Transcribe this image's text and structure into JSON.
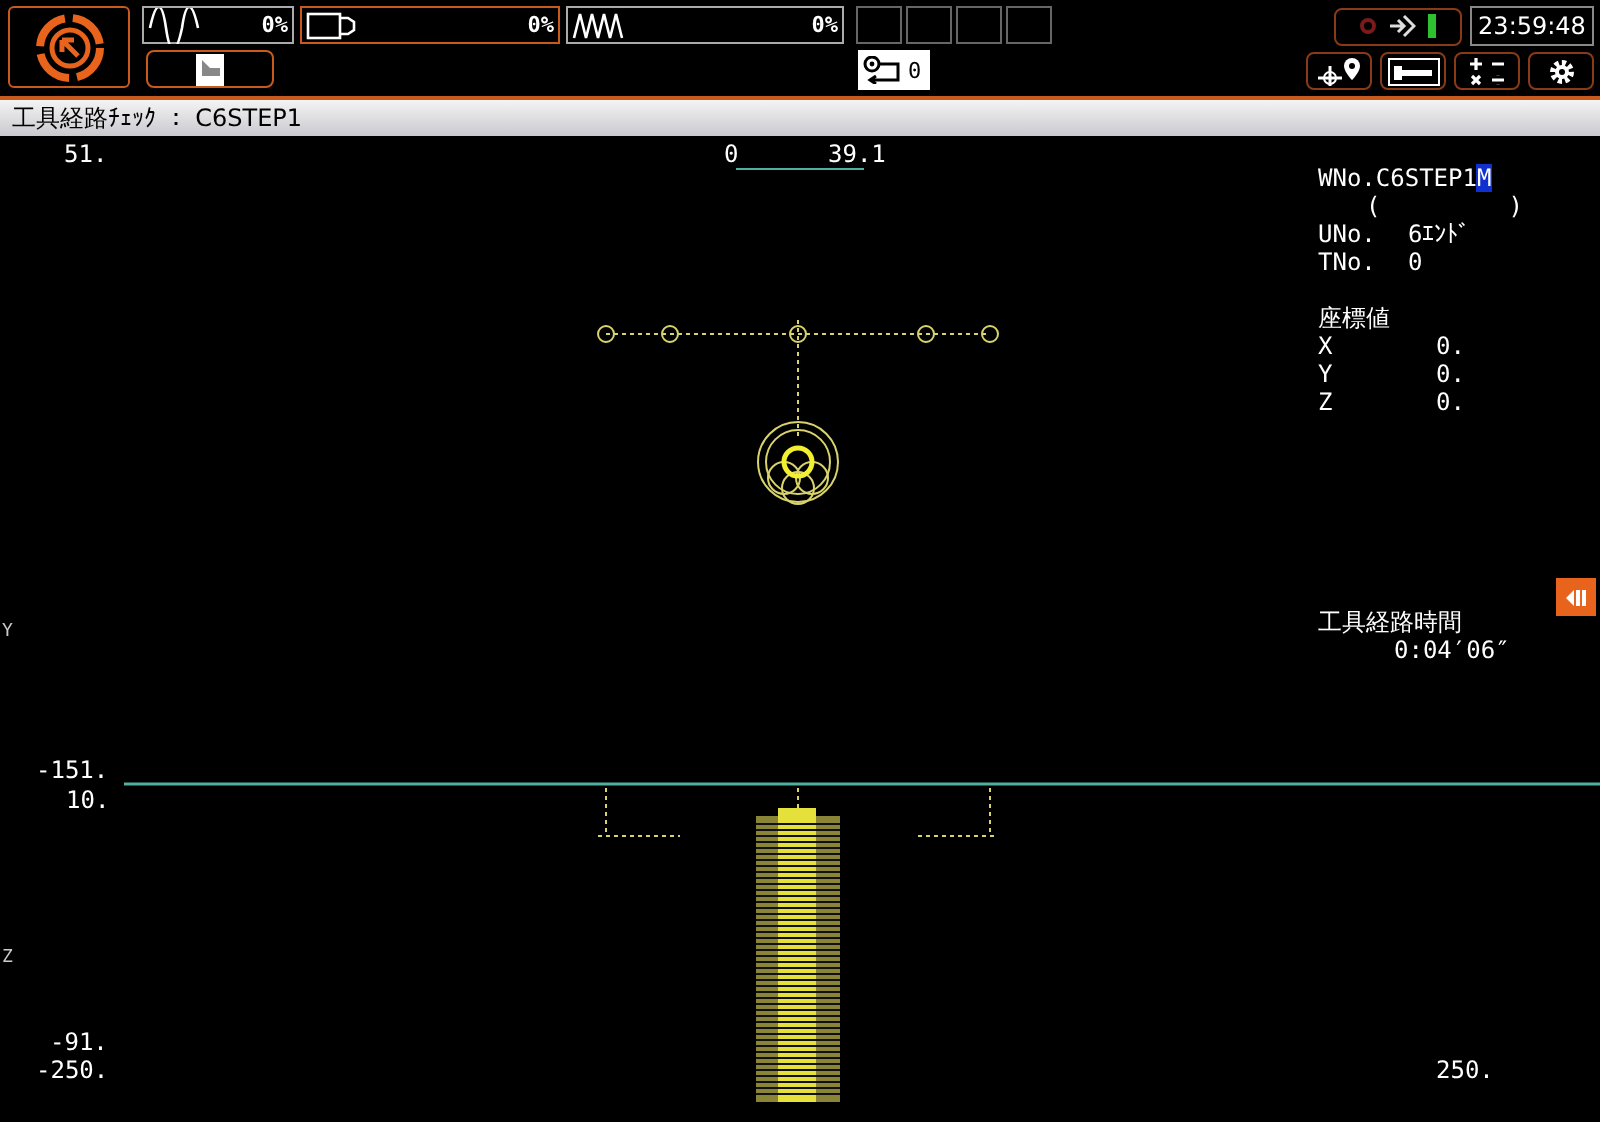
{
  "header": {
    "gauges": [
      {
        "kind": "sine",
        "reading": "0%"
      },
      {
        "kind": "tool",
        "reading": "0%"
      },
      {
        "kind": "triangle",
        "reading": "0%"
      }
    ],
    "counter": {
      "reading": "0"
    },
    "clock": "23:59:48"
  },
  "title_bar": {
    "title": "工具経路ﾁｪｯｸ ： C6STEP1"
  },
  "view": {
    "top_scale": {
      "left_value": "51.",
      "start": "0",
      "end": "39.1"
    },
    "upper_view": {
      "axis": "Y",
      "bottom_value": "-151."
    },
    "lower_view": {
      "axis": "Z",
      "top_value": "10.",
      "bottom_value": "-91.",
      "left_value": "-250.",
      "right_value": "250."
    }
  },
  "info": {
    "program_no": "WNo.C6STEP1",
    "cursor": "M",
    "comment_open": "(",
    "comment_close": ")",
    "unit_label": "UNo.",
    "unit_value": "6ｴﾝﾄﾞ",
    "tool_label": "TNo.",
    "tool_value": "0",
    "coords_title": "座標値",
    "coords": [
      {
        "axis": "X",
        "value": "0."
      },
      {
        "axis": "Y",
        "value": "0."
      },
      {
        "axis": "Z",
        "value": "0."
      }
    ],
    "time_title": "工具経路時間",
    "time_value": "0:04′06″"
  }
}
